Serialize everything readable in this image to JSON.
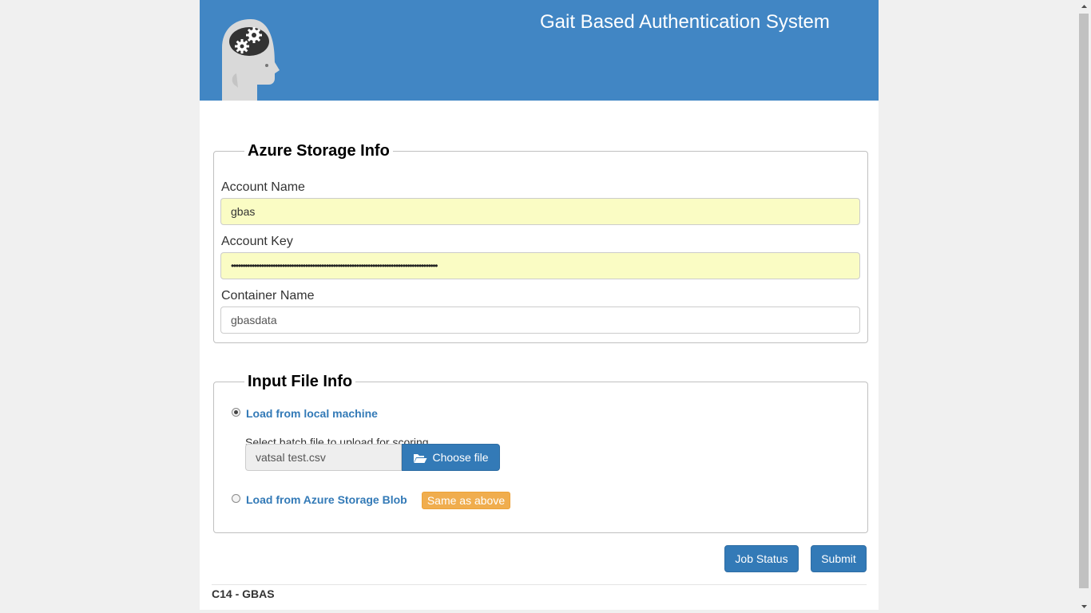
{
  "header": {
    "title": "Gait Based Authentication System",
    "logo": "head-gears-icon"
  },
  "storage": {
    "legend": "Azure Storage Info",
    "account_name_label": "Account Name",
    "account_name_value": "gbas",
    "account_key_label": "Account Key",
    "account_key_value": "•••••••••••••••••••••••••••••••••••••••••••••••••••••••••••••••••••••••••••••••••••••••••",
    "container_label": "Container Name",
    "container_value": "gbasdata"
  },
  "input_file": {
    "legend": "Input File Info",
    "local_option_label": "Load from local machine",
    "local_option_checked": true,
    "help_text": "Select batch file to upload for scoring",
    "file_name": "vatsal test.csv",
    "choose_button": "Choose file",
    "blob_option_label": "Load from Azure Storage Blob",
    "blob_option_checked": false,
    "same_badge": "Same as above"
  },
  "actions": {
    "job_status": "Job Status",
    "submit": "Submit"
  },
  "footer": {
    "text": "C14 - GBAS"
  },
  "colors": {
    "header_bg": "#4186c4",
    "primary": "#337ab7",
    "warning": "#f0ad4e",
    "autofill": "#fafcc4"
  }
}
